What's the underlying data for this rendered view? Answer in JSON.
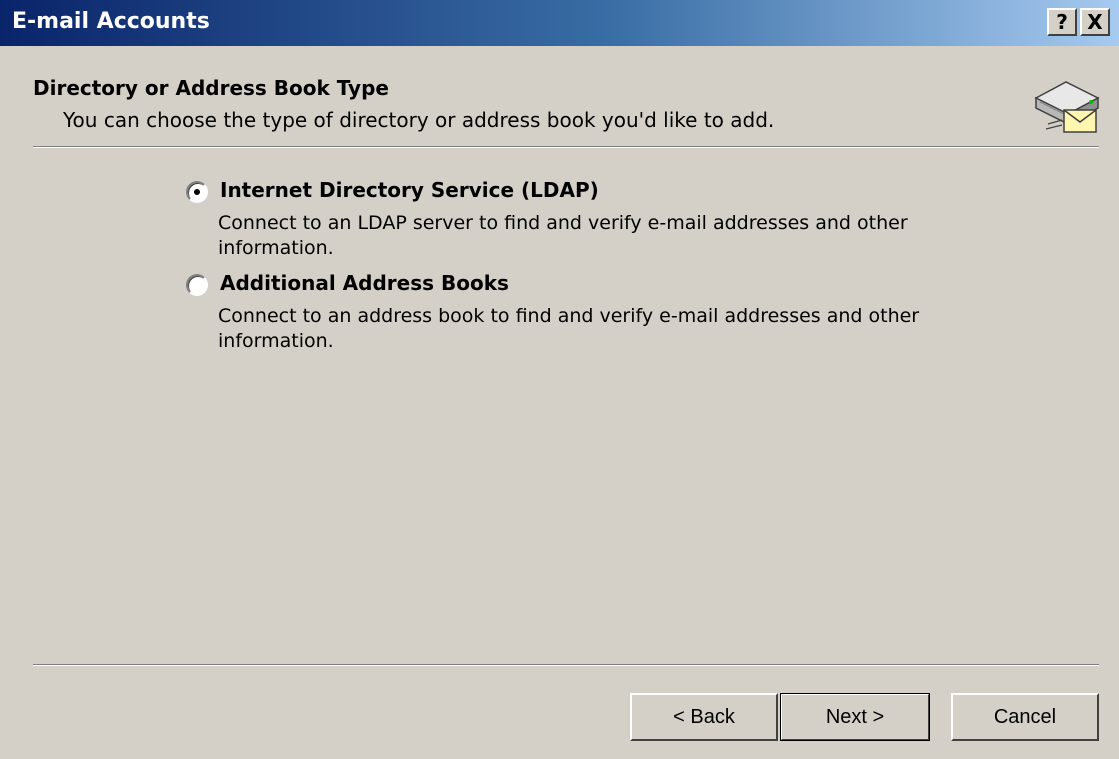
{
  "window": {
    "title": "E-mail Accounts",
    "help_button": "?",
    "close_button": "X"
  },
  "header": {
    "title": "Directory or Address Book Type",
    "subtitle": "You can choose the type of directory or address book you'd like to add.",
    "icon": "address-book-icon"
  },
  "options": [
    {
      "label": "Internet Directory Service (LDAP)",
      "description": "Connect to an LDAP server to find and verify e-mail addresses and other information.",
      "selected": true
    },
    {
      "label": "Additional Address Books",
      "description": "Connect to an address book to find and verify e-mail addresses and other information.",
      "selected": false
    }
  ],
  "buttons": {
    "back": "< Back",
    "next": "Next >",
    "cancel": "Cancel"
  },
  "colors": {
    "face": "#d4d0c8",
    "title_start": "#0a246a",
    "title_end": "#a6caf0"
  }
}
